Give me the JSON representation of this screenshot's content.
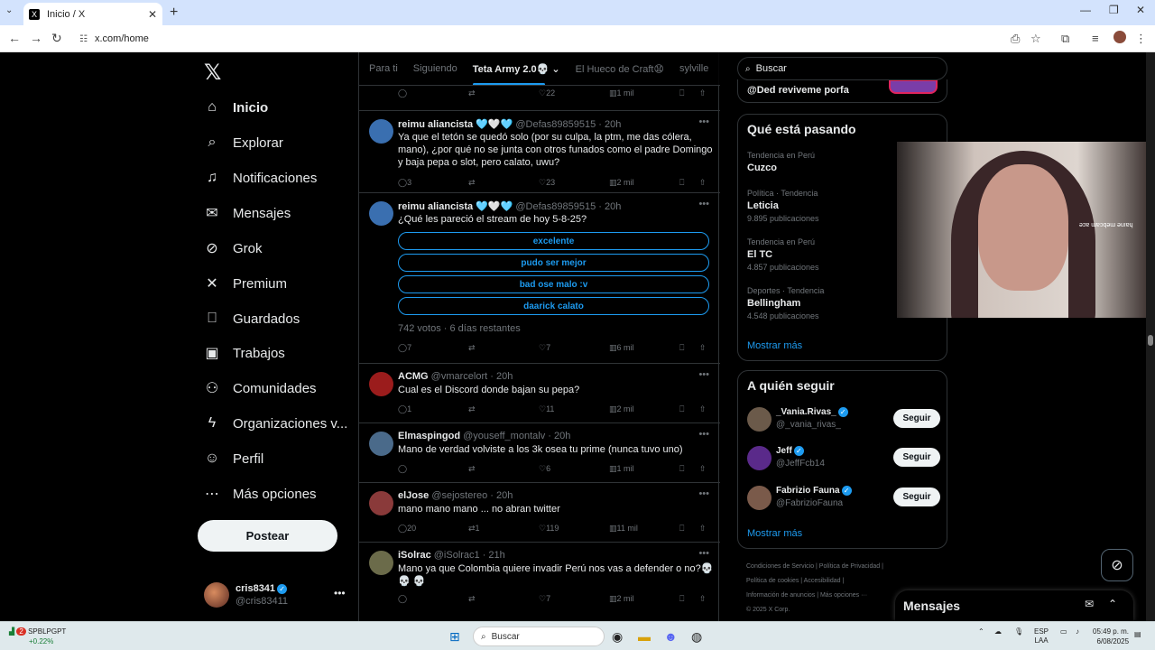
{
  "browser": {
    "tab_title": "Inicio / X",
    "url": "x.com/home"
  },
  "nav": {
    "items": [
      {
        "label": "Inicio",
        "icon": "home-icon",
        "glyph": "⌂"
      },
      {
        "label": "Explorar",
        "icon": "search-icon",
        "glyph": "⌕"
      },
      {
        "label": "Notificaciones",
        "icon": "bell-icon",
        "glyph": "♫"
      },
      {
        "label": "Mensajes",
        "icon": "envelope-icon",
        "glyph": "✉"
      },
      {
        "label": "Grok",
        "icon": "grok-icon",
        "glyph": "⊘"
      },
      {
        "label": "Premium",
        "icon": "x-icon",
        "glyph": "✕"
      },
      {
        "label": "Guardados",
        "icon": "bookmark-icon",
        "glyph": "⎕"
      },
      {
        "label": "Trabajos",
        "icon": "briefcase-icon",
        "glyph": "▣"
      },
      {
        "label": "Comunidades",
        "icon": "people-icon",
        "glyph": "⚇"
      },
      {
        "label": "Organizaciones v...",
        "icon": "lightning-icon",
        "glyph": "ϟ"
      },
      {
        "label": "Perfil",
        "icon": "person-icon",
        "glyph": "☺"
      },
      {
        "label": "Más opciones",
        "icon": "more-circle-icon",
        "glyph": "⋯"
      }
    ],
    "post_label": "Postear",
    "me": {
      "name": "cris8341",
      "handle": "@cris83411"
    }
  },
  "timeline": {
    "tabs": [
      "Para ti",
      "Siguiendo",
      "Teta Army 2.0💀",
      "El Hueco de Craft😧",
      "sylville"
    ],
    "top_actions": {
      "views": "1 mil",
      "likes": "22"
    },
    "tweets": [
      {
        "name": "reimu aliancista 🩵🤍🩵",
        "handle": "@Defas89859515 · 20h",
        "text": "Ya que el tetón se quedó solo (por su culpa, la ptm, me das cólera, mano), ¿por qué no se junta con otros funados como el padre Domingo y baja pepa o slot, pero calato, uwu?",
        "replies": "3",
        "retweets": "",
        "likes": "23",
        "views": "2 mil"
      },
      {
        "name": "reimu aliancista 🩵🤍🩵",
        "handle": "@Defas89859515 · 20h",
        "text": "¿Qué les pareció el stream de hoy 5-8-25?",
        "poll": [
          "excelente",
          "pudo ser mejor",
          "bad ose malo :v",
          "daarick calato"
        ],
        "poll_meta": "742 votos · 6 días restantes",
        "replies": "7",
        "retweets": "",
        "likes": "7",
        "views": "6 mil"
      },
      {
        "name": "ACMG",
        "handle": "@vmarcelort · 20h",
        "text": "Cual es el Discord donde bajan su pepa?",
        "replies": "1",
        "retweets": "",
        "likes": "11",
        "views": "2 mil"
      },
      {
        "name": "Elmaspingod",
        "handle": "@youseff_montalv · 20h",
        "text": "Mano de verdad volviste a los 3k osea tu prime (nunca tuvo uno)",
        "replies": "",
        "retweets": "",
        "likes": "6",
        "views": "1 mil"
      },
      {
        "name": "elJose",
        "handle": "@sejostereo · 20h",
        "text": "mano mano mano ... no abran twitter",
        "replies": "20",
        "retweets": "1",
        "likes": "119",
        "views": "11 mil"
      },
      {
        "name": "iSolrac",
        "handle": "@iSolrac1 · 21h",
        "text": "Mano ya que Colombia quiere invadir Perú nos vas a defender o no?💀💀 💀",
        "replies": "",
        "retweets": "",
        "likes": "7",
        "views": "2 mil"
      }
    ]
  },
  "right": {
    "search_placeholder": "Buscar",
    "partial_card": "@Ded reviveme porfa",
    "trends_title": "Qué está pasando",
    "trends": [
      {
        "ctx": "Tendencia en Perú",
        "title": "Cuzco",
        "count": ""
      },
      {
        "ctx": "Política · Tendencia",
        "title": "Leticia",
        "count": "9.895 publicaciones"
      },
      {
        "ctx": "Tendencia en Perú",
        "title": "El TC",
        "count": "4.857 publicaciones"
      },
      {
        "ctx": "Deportes · Tendencia",
        "title": "Bellingham",
        "count": "4.548 publicaciones"
      }
    ],
    "show_more": "Mostrar más",
    "who_title": "A quién seguir",
    "who": [
      {
        "name": "_Vania.Rivas_",
        "handle": "@_vania_rivas_"
      },
      {
        "name": "Jeff",
        "handle": "@JeffFcb14"
      },
      {
        "name": "Fabrizio Fauna",
        "handle": "@FabrizioFauna"
      }
    ],
    "follow_label": "Seguir",
    "footer": {
      "line1": "Condiciones de Servicio  |  Política de Privacidad  |",
      "line2": "Política de cookies  |  Accesibilidad  |",
      "line3": "Información de anuncios  |  Más opciones ···",
      "line4": "© 2025 X Corp."
    },
    "webcam_caption": "ǝɔɐ ɯɐɔqǝɯ ǝuıɐɥ",
    "messages_label": "Mensajes"
  },
  "taskbar": {
    "stock_name": "SPBLPGPT",
    "stock_change": "+0.22%",
    "search": "Buscar",
    "lang": "ESP",
    "lang2": "LAA",
    "time": "05:49 p. m.",
    "date": "6/08/2025",
    "badge": "2"
  },
  "colors": {
    "accent": "#1d9bf0",
    "bg": "#000000",
    "text": "#e7e9ea",
    "muted": "#71767b"
  }
}
